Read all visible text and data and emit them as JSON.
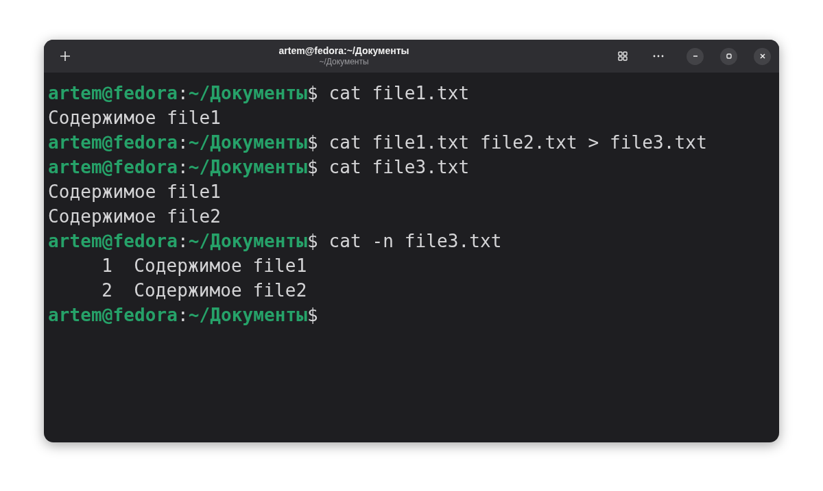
{
  "window": {
    "title": "artem@fedora:~/Документы",
    "subtitle": "~/Документы"
  },
  "lines": [
    {
      "kind": "prompt",
      "user_host": "artem@fedora",
      "separator": ":",
      "path": "~/Документы",
      "symbol": "$",
      "command": "cat file1.txt"
    },
    {
      "kind": "output",
      "text": "Содержимое file1"
    },
    {
      "kind": "prompt",
      "user_host": "artem@fedora",
      "separator": ":",
      "path": "~/Документы",
      "symbol": "$",
      "command": "cat file1.txt file2.txt > file3.txt"
    },
    {
      "kind": "prompt",
      "user_host": "artem@fedora",
      "separator": ":",
      "path": "~/Документы",
      "symbol": "$",
      "command": "cat file3.txt"
    },
    {
      "kind": "output",
      "text": "Содержимое file1"
    },
    {
      "kind": "output",
      "text": "Содержимое file2"
    },
    {
      "kind": "prompt",
      "user_host": "artem@fedora",
      "separator": ":",
      "path": "~/Документы",
      "symbol": "$",
      "command": "cat -n file3.txt"
    },
    {
      "kind": "numbered",
      "number": "1",
      "text": "Содержимое file1"
    },
    {
      "kind": "numbered",
      "number": "2",
      "text": "Содержимое file2"
    },
    {
      "kind": "prompt",
      "user_host": "artem@fedora",
      "separator": ":",
      "path": "~/Документы",
      "symbol": "$"
    }
  ]
}
